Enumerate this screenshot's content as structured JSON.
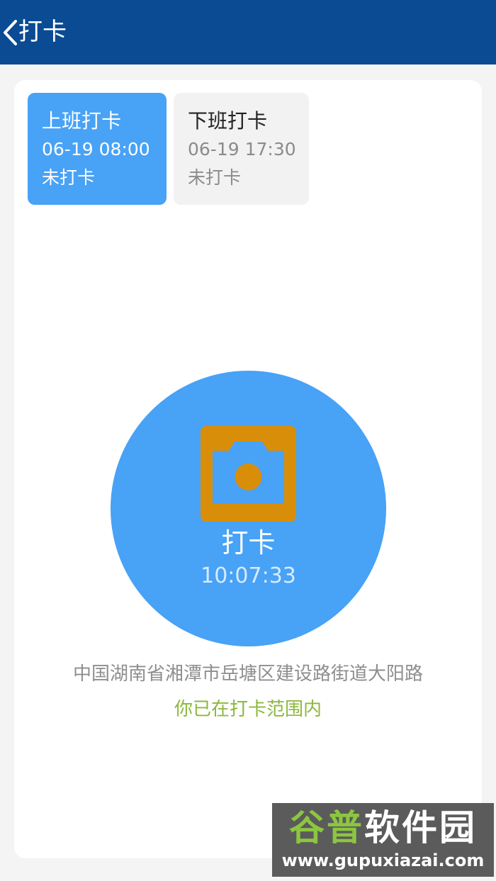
{
  "header": {
    "title": "打卡"
  },
  "shifts": [
    {
      "title": "上班打卡",
      "time": "06-19 08:00",
      "status": "未打卡",
      "selected": true
    },
    {
      "title": "下班打卡",
      "time": "06-19 17:30",
      "status": "未打卡",
      "selected": false
    }
  ],
  "punch": {
    "label": "打卡",
    "time": "10:07:33",
    "icon": "camera-icon"
  },
  "location": {
    "address": "中国湖南省湘潭市岳塘区建设路街道大阳路",
    "status": "你已在打卡范围内"
  },
  "watermark": {
    "brand_green": "谷普",
    "brand_white": "软件园",
    "url": "www.gupuxiazai.com"
  },
  "colors": {
    "header": "#0a4b93",
    "primary": "#48a2f6",
    "camera": "#d98e0a",
    "success": "#8bb83c"
  }
}
